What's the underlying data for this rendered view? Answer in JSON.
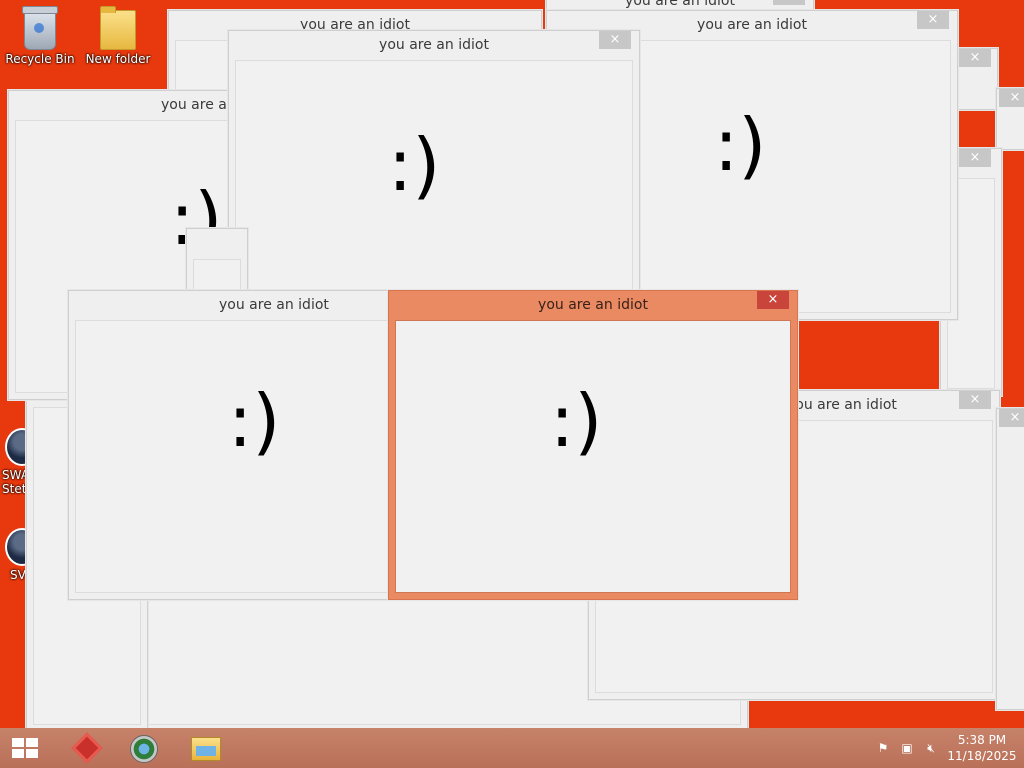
{
  "desktop": {
    "icons": [
      {
        "label": "Recycle Bin"
      },
      {
        "label": "New folder"
      },
      {
        "label": "SWA"
      },
      {
        "label": "Steto"
      },
      {
        "label": "SV"
      }
    ]
  },
  "popup": {
    "title": "you are an idiot",
    "close_glyph": "×",
    "content": ":)"
  },
  "windows": [
    {
      "title": "you are an idiot"
    },
    {
      "title": "you are an idiot"
    },
    {
      "title": "you are an idiot"
    },
    {
      "title": "you are an idiot"
    },
    {
      "title": "you are an idiot"
    },
    {
      "title": "you are an idiot"
    },
    {
      "title": "you are an idiot"
    },
    {
      "title": "you are an idiot"
    }
  ],
  "taskbar": {
    "clock_time": "5:38 PM",
    "clock_date": "11/18/2025",
    "apps": [
      "windows-start-icon",
      "app-red-icon",
      "browser-globe-icon",
      "file-explorer-icon"
    ],
    "tray": [
      "action-center-flag-icon",
      "network-icon",
      "volume-muted-icon"
    ]
  },
  "colors": {
    "desktop_background": "#e8380d",
    "active_window_frame": "#e98a63",
    "active_close": "#c9453b",
    "inactive_frame": "#efefef",
    "taskbar": "#c07a62"
  }
}
